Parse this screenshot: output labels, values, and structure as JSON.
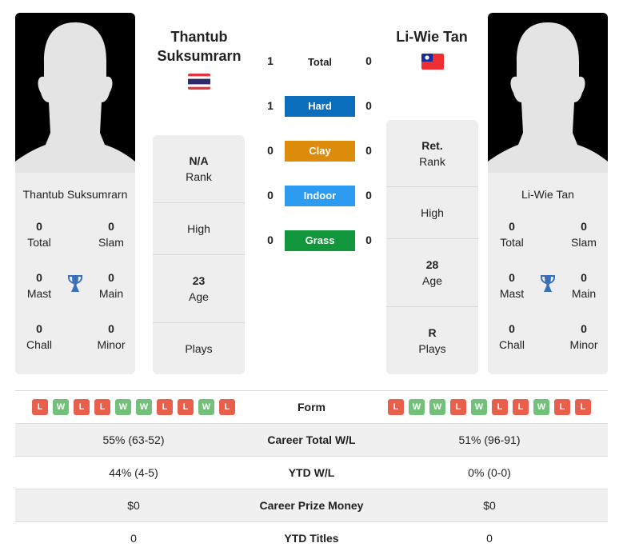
{
  "player1": {
    "name": "Thantub Suksumrarn",
    "name_lines": [
      "Thantub",
      "Suksumrarn"
    ],
    "country_flag": "thailand-flag",
    "titles": {
      "total": {
        "value": "0",
        "label": "Total"
      },
      "slam": {
        "value": "0",
        "label": "Slam"
      },
      "mast": {
        "value": "0",
        "label": "Mast"
      },
      "main": {
        "value": "0",
        "label": "Main"
      },
      "chall": {
        "value": "0",
        "label": "Chall"
      },
      "minor": {
        "value": "0",
        "label": "Minor"
      }
    },
    "info": {
      "rank": {
        "value": "N/A",
        "label": "Rank"
      },
      "high": {
        "value": "",
        "label": "High"
      },
      "age": {
        "value": "23",
        "label": "Age"
      },
      "plays": {
        "value": "",
        "label": "Plays"
      }
    },
    "form": [
      "L",
      "W",
      "L",
      "L",
      "W",
      "W",
      "L",
      "L",
      "W",
      "L"
    ],
    "career_total_wl": "55% (63-52)",
    "ytd_wl": "44% (4-5)",
    "career_prize_money": "$0",
    "ytd_titles": "0"
  },
  "player2": {
    "name": "Li-Wie Tan",
    "country_flag": "taiwan-flag",
    "titles": {
      "total": {
        "value": "0",
        "label": "Total"
      },
      "slam": {
        "value": "0",
        "label": "Slam"
      },
      "mast": {
        "value": "0",
        "label": "Mast"
      },
      "main": {
        "value": "0",
        "label": "Main"
      },
      "chall": {
        "value": "0",
        "label": "Chall"
      },
      "minor": {
        "value": "0",
        "label": "Minor"
      }
    },
    "info": {
      "rank": {
        "value": "Ret.",
        "label": "Rank"
      },
      "high": {
        "value": "",
        "label": "High"
      },
      "age": {
        "value": "28",
        "label": "Age"
      },
      "plays": {
        "value": "R",
        "label": "Plays"
      }
    },
    "form": [
      "L",
      "W",
      "W",
      "L",
      "W",
      "L",
      "L",
      "W",
      "L",
      "L"
    ],
    "career_total_wl": "51% (96-91)",
    "ytd_wl": "0% (0-0)",
    "career_prize_money": "$0",
    "ytd_titles": "0"
  },
  "h2h": {
    "total": {
      "label": "Total",
      "p1": "1",
      "p2": "0"
    },
    "surfaces": [
      {
        "label": "Hard",
        "p1": "1",
        "p2": "0",
        "color": "#0a6ebd"
      },
      {
        "label": "Clay",
        "p1": "0",
        "p2": "0",
        "color": "#dc8c0a"
      },
      {
        "label": "Indoor",
        "p1": "0",
        "p2": "0",
        "color": "#2d9bf0"
      },
      {
        "label": "Grass",
        "p1": "0",
        "p2": "0",
        "color": "#12963c"
      }
    ]
  },
  "stats_labels": {
    "form": "Form",
    "career_total_wl": "Career Total W/L",
    "ytd_wl": "YTD W/L",
    "career_prize_money": "Career Prize Money",
    "ytd_titles": "YTD Titles"
  },
  "colors": {
    "loss": "#e8604c",
    "win": "#72c07a",
    "trophy": "#3a70b8",
    "panel": "#eeeeee"
  }
}
